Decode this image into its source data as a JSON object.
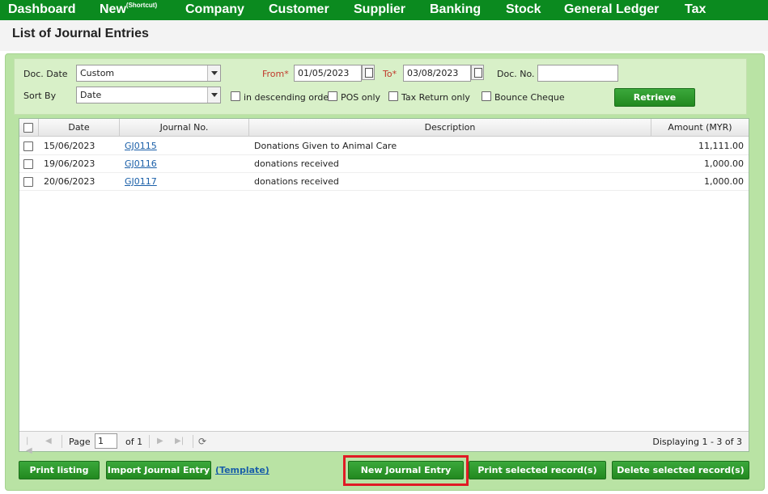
{
  "nav": {
    "items": [
      "Dashboard",
      "New",
      "Company",
      "Customer",
      "Supplier",
      "Banking",
      "Stock",
      "General Ledger",
      "Tax"
    ],
    "new_sup": "(Shortcut)"
  },
  "page": {
    "title": "List of Journal Entries"
  },
  "filters": {
    "doc_date_label": "Doc. Date",
    "doc_date_value": "Custom",
    "from_label": "From*",
    "from_value": "01/05/2023",
    "to_label": "To*",
    "to_value": "03/08/2023",
    "doc_no_label": "Doc. No.",
    "doc_no_value": "",
    "sort_by_label": "Sort By",
    "sort_by_value": "Date",
    "descending_label": "in descending order",
    "pos_only_label": "POS only",
    "tax_return_label": "Tax Return only",
    "bounce_cheque_label": "Bounce Cheque",
    "retrieve_label": "Retrieve"
  },
  "grid": {
    "headers": {
      "date": "Date",
      "journal_no": "Journal No.",
      "description": "Description",
      "amount": "Amount (MYR)"
    },
    "rows": [
      {
        "date": "15/06/2023",
        "journal_no": "GJ0115",
        "description": "Donations Given to Animal Care",
        "amount": "11,111.00"
      },
      {
        "date": "19/06/2023",
        "journal_no": "GJ0116",
        "description": "donations received",
        "amount": "1,000.00"
      },
      {
        "date": "20/06/2023",
        "journal_no": "GJ0117",
        "description": "donations received",
        "amount": "1,000.00"
      }
    ]
  },
  "pager": {
    "page_label": "Page",
    "page_value": "1",
    "of_label": "of 1",
    "displaying": "Displaying 1 - 3 of 3"
  },
  "actions": {
    "print_listing": "Print listing",
    "import_journal": "Import Journal Entry",
    "template": "(Template)",
    "new_journal": "New Journal Entry",
    "print_selected": "Print selected record(s)",
    "delete_selected": "Delete selected record(s)"
  }
}
